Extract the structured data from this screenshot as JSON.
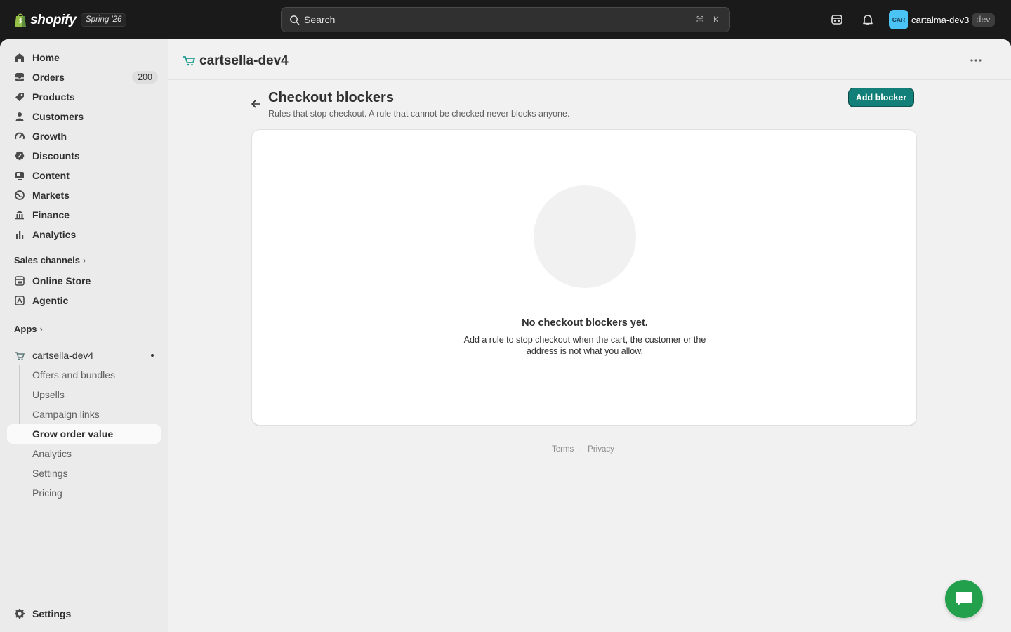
{
  "topbar": {
    "brand": "shopify",
    "edition": "Spring '26",
    "search_placeholder": "Search",
    "search_shortcut_1": "⌘",
    "search_shortcut_2": "K",
    "account_initials": "CAR",
    "account_name": "cartalma-dev3",
    "account_badge": "dev"
  },
  "sidebar": {
    "items": [
      {
        "label": "Home",
        "icon": "home-icon"
      },
      {
        "label": "Orders",
        "icon": "orders-icon",
        "badge": "200"
      },
      {
        "label": "Products",
        "icon": "tag-icon"
      },
      {
        "label": "Customers",
        "icon": "person-icon"
      },
      {
        "label": "Growth",
        "icon": "gauge-icon"
      },
      {
        "label": "Discounts",
        "icon": "discount-icon"
      },
      {
        "label": "Content",
        "icon": "content-icon"
      },
      {
        "label": "Markets",
        "icon": "globe-icon"
      },
      {
        "label": "Finance",
        "icon": "bank-icon"
      },
      {
        "label": "Analytics",
        "icon": "bar-chart-icon"
      }
    ],
    "sales_channels_header": "Sales channels",
    "sales_channels": [
      {
        "label": "Online Store",
        "icon": "store-icon"
      },
      {
        "label": "Agentic",
        "icon": "agentic-icon"
      }
    ],
    "apps_header": "Apps",
    "app_name": "cartsella-dev4",
    "app_subitems": [
      {
        "label": "Offers and bundles"
      },
      {
        "label": "Upsells"
      },
      {
        "label": "Campaign links"
      },
      {
        "label": "Grow order value",
        "active": true
      },
      {
        "label": "Analytics"
      },
      {
        "label": "Settings"
      },
      {
        "label": "Pricing"
      }
    ],
    "settings_label": "Settings"
  },
  "main": {
    "app_title": "cartsella-dev4",
    "page_title": "Checkout blockers",
    "page_subtitle": "Rules that stop checkout. A rule that cannot be checked never blocks anyone.",
    "primary_action": "Add blocker",
    "empty_state": {
      "title": "No checkout blockers yet.",
      "description": "Add a rule to stop checkout when the cart, the customer or the address is not what you allow."
    },
    "footer": {
      "terms": "Terms",
      "separator": "·",
      "privacy": "Privacy"
    }
  },
  "colors": {
    "topbar_bg": "#1a1a1a",
    "primary_button": "#128078",
    "chat_button": "#22a04b",
    "avatar": "#4ac3f5"
  }
}
